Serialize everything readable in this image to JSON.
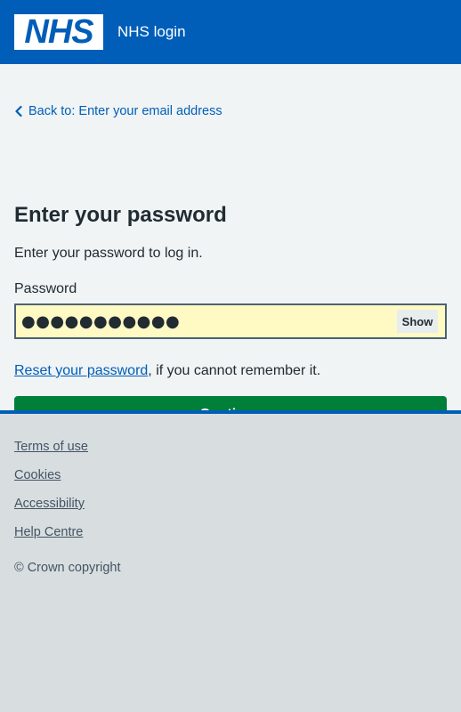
{
  "header": {
    "logo_text": "NHS",
    "service_name": "NHS login"
  },
  "main": {
    "back_link": "Back to: Enter your email address",
    "title": "Enter your password",
    "hint": "Enter your password to log in.",
    "password_label": "Password",
    "password_value": "●●●●●●●●●●●",
    "show_label": "Show",
    "reset_link": "Reset your password",
    "reset_suffix": ", if you cannot remember it.",
    "continue_label": "Continue"
  },
  "footer": {
    "links": [
      "Terms of use",
      "Cookies",
      "Accessibility",
      "Help Centre"
    ],
    "copyright": "© Crown copyright"
  },
  "colors": {
    "nhs_blue": "#005eb8",
    "green": "#007f3b",
    "input_bg": "#fff9c4",
    "page_bg": "#f0f4f5",
    "footer_bg": "#d8dde0"
  }
}
